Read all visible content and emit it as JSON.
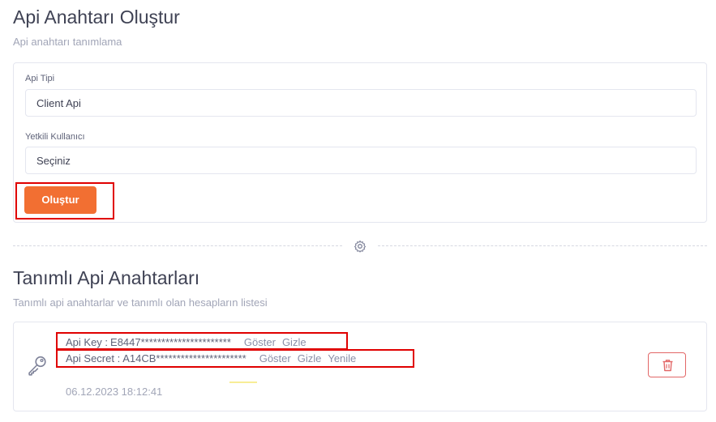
{
  "create": {
    "title": "Api Anahtarı Oluştur",
    "subtitle": "Api anahtarı tanımlama",
    "api_type_label": "Api Tipi",
    "api_type_value": "Client Api",
    "user_label": "Yetkili Kullanıcı",
    "user_value": "Seçiniz",
    "submit_label": "Oluştur"
  },
  "list": {
    "title": "Tanımlı Api Anahtarları",
    "subtitle": "Tanımlı api anahtarlar ve tanımlı olan hesapların listesi",
    "items": [
      {
        "api_key_label": "Api Key :",
        "api_key_value": "E8447**********************",
        "api_key_show": "Göster",
        "api_key_hide": "Gizle",
        "api_secret_label": "Api Secret :",
        "api_secret_value": "A14CB**********************",
        "api_secret_show": "Göster",
        "api_secret_hide": "Gizle",
        "api_secret_renew": "Yenile",
        "date": "06.12.2023 18:12:41"
      }
    ]
  },
  "icons": {
    "divider": "gear-icon",
    "item": "key-icon",
    "delete": "trash-icon"
  },
  "colors": {
    "accent": "#f26f32",
    "danger": "#e26767",
    "highlight": "#e00000"
  }
}
